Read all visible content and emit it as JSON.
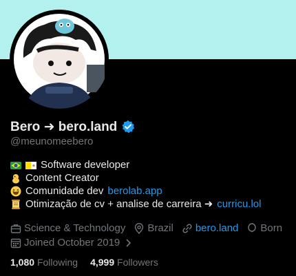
{
  "profile": {
    "display_name": "Bero ➜ bero.land",
    "handle": "@meunomeebero",
    "verified_icon": "verified-badge-icon"
  },
  "bio": {
    "line1": "Software developer",
    "line2": "Content Creator",
    "line3_prefix": "Comunidade dev",
    "line3_link": "berolab.app",
    "line4_prefix": "Otimização de cv + analise de carreira ➜",
    "line4_link": "curricu.lol"
  },
  "meta": {
    "category": "Science & Technology",
    "location": "Brazil",
    "website": "bero.land",
    "born": "Born",
    "joined": "Joined October 2019"
  },
  "stats": {
    "following_count": "1,080",
    "following_label": "Following",
    "followers_count": "4,999",
    "followers_label": "Followers"
  },
  "colors": {
    "banner": "#b3f1ee",
    "link": "#1d9bf0",
    "muted": "#71767b",
    "text": "#e7e9ea"
  }
}
